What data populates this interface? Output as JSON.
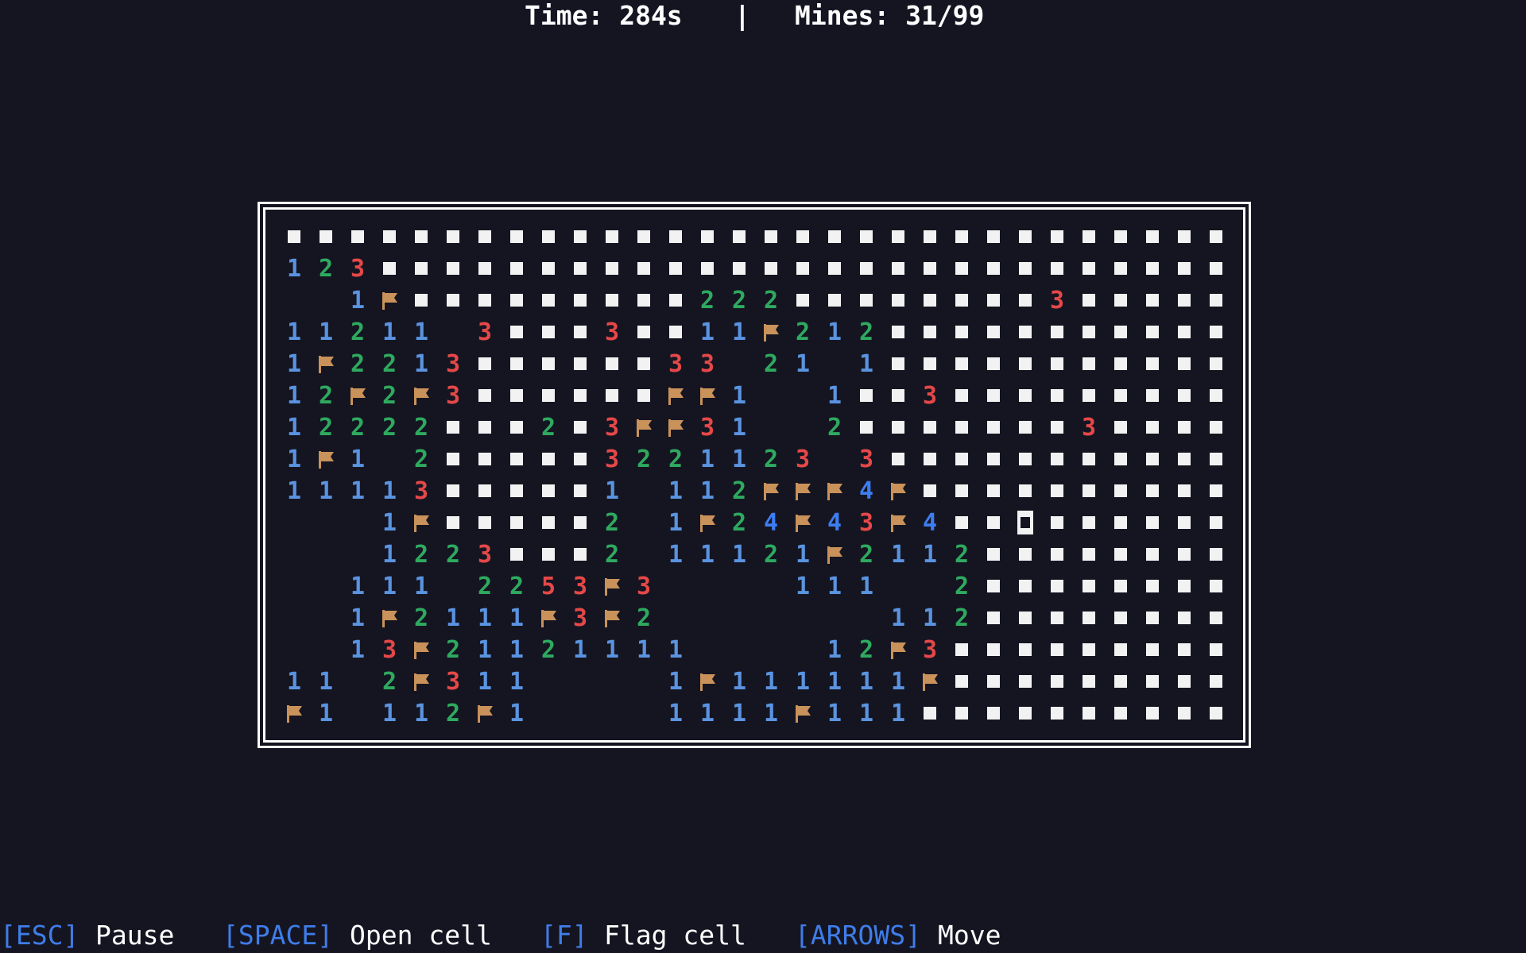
{
  "status": {
    "time": "Time: 284s",
    "separator": "|",
    "mines": "Mines: 31/99"
  },
  "board": {
    "cols": 30,
    "rows": 16,
    "cursor": {
      "row": 9,
      "col": 23
    },
    "legend": {
      "#": "unopened",
      "F": "flag",
      ".": "empty",
      "1-8": "number"
    },
    "cells": [
      "##############################",
      "123###########################",
      "..1F#########222########3#####",
      "11211 3###3##11F212###########",
      "1F2213######33 21.1###########",
      "12F2F3######FF1..1##3#########",
      "12222###2#3FF31..2#######3####",
      "1F1.2#####3221123 3###########",
      "11113#####1.112FFF4F##########",
      "...1F#####2.1F24F43F4#########",
      "...1223###2.11121F2112########",
      "..111.2253F3....111..2########",
      "..1F2111F3F2.......112########",
      "..13F21121111....12F3#########",
      "11.2F311....1F111111F#########",
      "F1.112F1....1111F111##########"
    ],
    "colors": {
      "1": "#5a93e0",
      "2": "#2eaa5f",
      "3": "#e54848",
      "4": "#3d7df0",
      "5": "#e54848",
      "flag": "#c9925a",
      "unopened": "#f2f2f2"
    }
  },
  "help": [
    {
      "key": "[ESC]",
      "label": "Pause"
    },
    {
      "key": "[SPACE]",
      "label": "Open cell"
    },
    {
      "key": "[F]",
      "label": "Flag cell"
    },
    {
      "key": "[ARROWS]",
      "label": "Move"
    }
  ]
}
